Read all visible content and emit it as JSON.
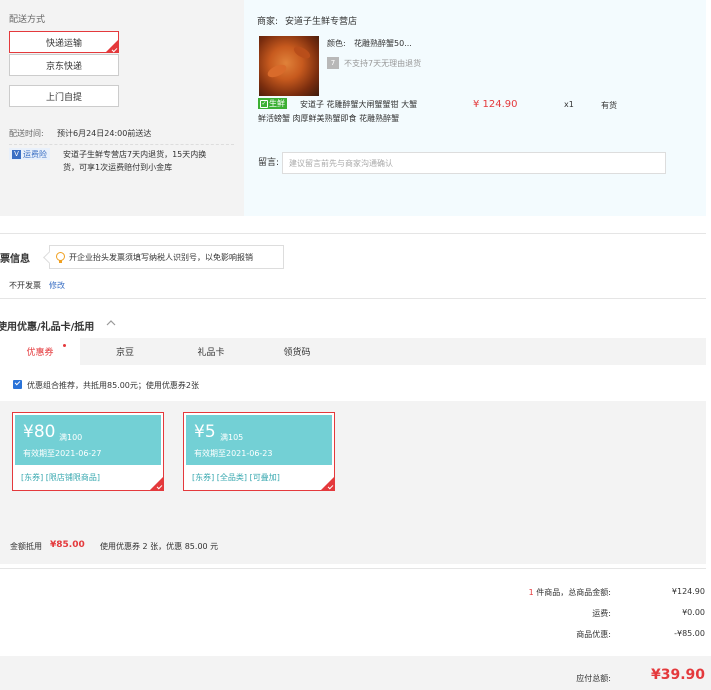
{
  "shipping": {
    "title": "配送方式",
    "options": [
      "快递运输",
      "京东快递",
      "上门自提"
    ],
    "selected_index": 0,
    "delivery_time_label": "配送时间:",
    "delivery_time_value": "预计6月24日24:00前送达",
    "service_badge": "运费险",
    "service_desc_line1": "安道子生鲜专营店7天内退货，15天内换",
    "service_desc_line2": "货，可享1次运费赔付到小金库"
  },
  "order": {
    "shop_label": "商家:",
    "shop_name": "安道子生鲜专营店",
    "color_label": "颜色:",
    "color_value": "花雕熟醉蟹50...",
    "return_policy": "不支持7天无理由退货",
    "fresh_tag": "生鲜",
    "product_name_line1": "安道子 花雕醉蟹大闸蟹蟹钳 大蟹",
    "product_name_line2": "鲜活螃蟹 肉厚鲜美熟蟹即食 花雕熟醉蟹",
    "price": "¥ 124.90",
    "quantity": "x1",
    "stock": "有货",
    "remark_label": "留言:",
    "remark_placeholder": "建议留言前先与商家沟通确认"
  },
  "invoice": {
    "title": "发票信息",
    "tooltip": "开企业抬头发票须填写纳税人识别号，以免影响报销",
    "status": "不开发票",
    "edit_link": "修改"
  },
  "discount": {
    "title": "使用优惠/礼品卡/抵用",
    "tabs": [
      "优惠券",
      "京豆",
      "礼品卡",
      "领货码"
    ],
    "active_tab": 0,
    "recommend_text": "优惠组合推荐，共抵用85.00元；使用优惠券2张",
    "coupons": [
      {
        "amount": "¥80",
        "condition": "满100",
        "validity": "有效期至2021-06-27",
        "tags": "[东券]  [限店铺限商品]"
      },
      {
        "amount": "¥5",
        "condition": "满105",
        "validity": "有效期至2021-06-23",
        "tags": "[东券]  [全品类]  [可叠加]"
      }
    ],
    "deduct_label": "金额抵用",
    "deduct_value": "¥85.00",
    "deduct_desc": "使用优惠券 2 张，优惠 85.00 元"
  },
  "summary": {
    "count": "1",
    "items_label": "件商品，总商品金额:",
    "items_total": "¥124.90",
    "shipping_label": "运费:",
    "shipping_value": "¥0.00",
    "discount_label": "商品优惠:",
    "discount_value": "-¥85.00",
    "payable_label": "应付总额:",
    "payable_value": "¥39.90"
  },
  "colors": {
    "accent": "#e4393c",
    "coupon_teal": "#73d0d5",
    "link": "#3a6fc4",
    "fresh_green": "#3cb034"
  },
  "icons": [
    "check-corner-icon",
    "shield-icon",
    "bulb-icon",
    "checkbox-icon",
    "chevron-up-icon",
    "fresh-icon"
  ]
}
